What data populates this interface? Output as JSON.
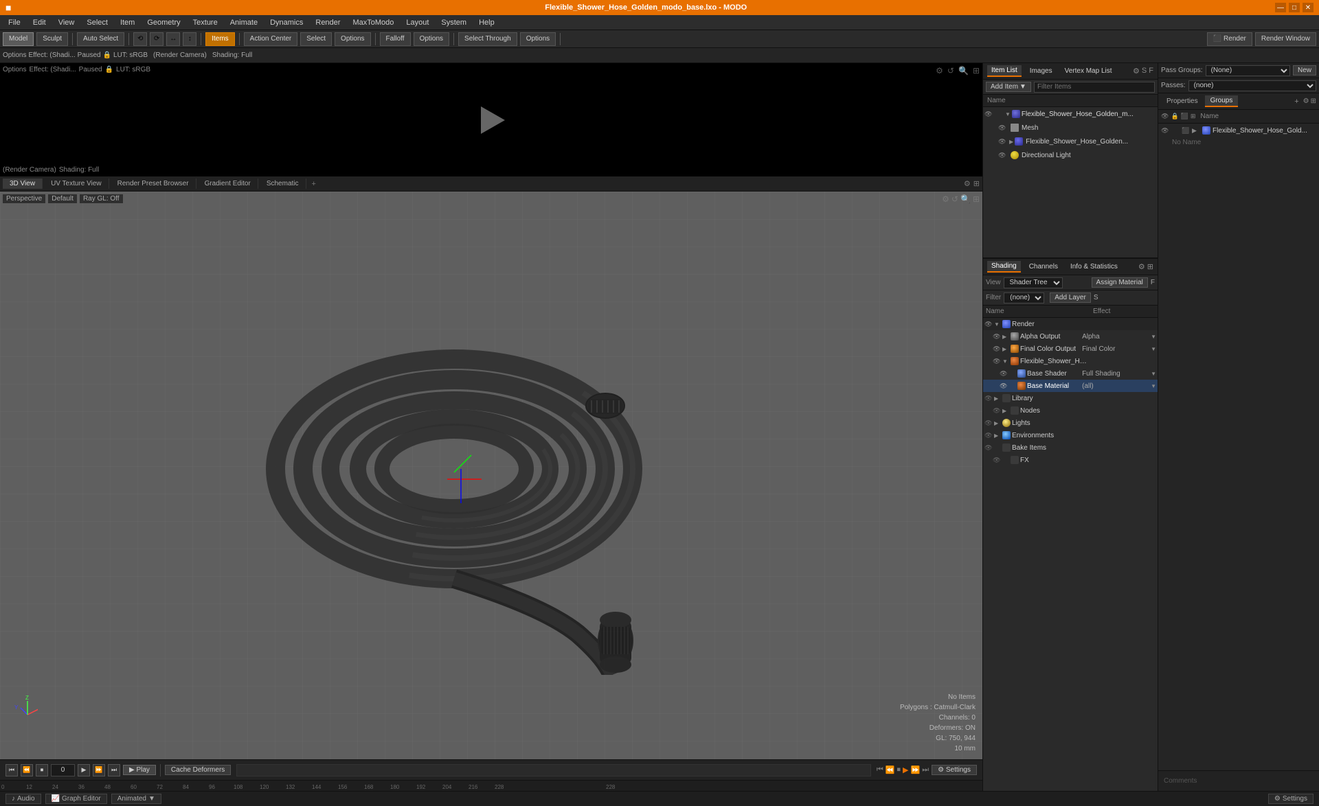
{
  "titleBar": {
    "title": "Flexible_Shower_Hose_Golden_modo_base.lxo - MODO",
    "winButtons": [
      "—",
      "□",
      "✕"
    ]
  },
  "menuBar": {
    "items": [
      "File",
      "Edit",
      "View",
      "Select",
      "Item",
      "Geometry",
      "Texture",
      "Animate",
      "Dynamics",
      "Render",
      "MaxToModo",
      "Layout",
      "System",
      "Help"
    ]
  },
  "toolbar": {
    "modeButtons": [
      "Model",
      "Sculpt"
    ],
    "autoSelect": "Auto Select",
    "transformButtons": [
      "⟲",
      "⟳",
      "↔",
      "↕"
    ],
    "itemsBtn": "Items",
    "actionCenter": "Action Center",
    "selectBtn": "Select",
    "optionsBtn1": "Options",
    "falloffBtn": "Falloff",
    "optionsBtn2": "Options",
    "selectThrough": "Select Through",
    "optionsBtn3": "Options",
    "renderBtn": "Render",
    "renderWindow": "Render Window"
  },
  "optionsBar": {
    "effect": "Effect: (Shadi...",
    "paused": "Paused",
    "lut": "LUT: sRGB",
    "renderCamera": "(Render Camera)",
    "shading": "Shading: Full"
  },
  "viewportTabs": {
    "tabs": [
      "3D View",
      "UV Texture View",
      "Render Preset Browser",
      "Gradient Editor",
      "Schematic",
      "+"
    ]
  },
  "viewport": {
    "perspective": "Perspective",
    "default": "Default",
    "rayGL": "Ray GL: Off",
    "noItems": "No Items",
    "polygons": "Polygons : Catmull-Clark",
    "channels": "Channels: 0",
    "deformers": "Deformers: ON",
    "gl": "GL: 750, 944",
    "scale": "10 mm"
  },
  "previewArea": {
    "options": "Options",
    "effect": "Effect: (Shadi...)",
    "paused": "Paused",
    "lut": "LUT: sRGB",
    "renderCamera": "(Render Camera)",
    "shading": "Shading: Full"
  },
  "itemListPanel": {
    "tabs": [
      "Item List",
      "Images",
      "Vertex Map List"
    ],
    "addItem": "Add Item",
    "filterItems": "Filter Items",
    "colHeader": "Name",
    "items": [
      {
        "level": 0,
        "name": "Flexible_Shower_Hose_Golden_m...",
        "expanded": true,
        "eye": true
      },
      {
        "level": 1,
        "name": "Mesh",
        "expanded": false,
        "eye": true
      },
      {
        "level": 1,
        "name": "Flexible_Shower_Hose_Golden...",
        "expanded": false,
        "eye": true
      },
      {
        "level": 1,
        "name": "Directional Light",
        "expanded": false,
        "eye": true
      }
    ]
  },
  "shadingPanel": {
    "tabs": [
      "Shading",
      "Channels",
      "Info & Statistics"
    ],
    "viewLabel": "View",
    "viewValue": "Shader Tree",
    "assignMaterial": "Assign Material",
    "filterLabel": "Filter",
    "filterValue": "(none)",
    "addLayer": "Add Layer",
    "colName": "Name",
    "colEffect": "Effect",
    "rows": [
      {
        "level": 0,
        "name": "Render",
        "effect": "",
        "icon": "render",
        "expanded": true,
        "eye": true
      },
      {
        "level": 1,
        "name": "Alpha Output",
        "effect": "Alpha",
        "icon": "output",
        "hasArrow": true,
        "eye": true
      },
      {
        "level": 1,
        "name": "Final Color Output",
        "effect": "Final Color",
        "icon": "output",
        "hasArrow": true,
        "eye": true
      },
      {
        "level": 1,
        "name": "Flexible_Shower_Hose_Gol...",
        "effect": "",
        "icon": "material",
        "expanded": true,
        "eye": true
      },
      {
        "level": 2,
        "name": "Base Shader",
        "effect": "Full Shading",
        "icon": "shader",
        "hasArrow": true,
        "eye": true
      },
      {
        "level": 2,
        "name": "Base Material",
        "effect": "(all)",
        "icon": "material2",
        "hasArrow": true,
        "eye": true
      },
      {
        "level": 0,
        "name": "Library",
        "effect": "",
        "icon": "library",
        "expanded": false,
        "eye": false
      },
      {
        "level": 1,
        "name": "Nodes",
        "effect": "",
        "icon": "nodes",
        "expanded": false,
        "eye": false
      },
      {
        "level": 0,
        "name": "Lights",
        "effect": "",
        "icon": "lights",
        "expanded": false,
        "eye": false
      },
      {
        "level": 0,
        "name": "Environments",
        "effect": "",
        "icon": "env",
        "expanded": false,
        "eye": false
      },
      {
        "level": 0,
        "name": "Bake Items",
        "effect": "",
        "icon": "bake",
        "expanded": false,
        "eye": false
      },
      {
        "level": 1,
        "name": "FX",
        "effect": "",
        "icon": "fx",
        "expanded": false,
        "eye": false
      }
    ]
  },
  "passGroups": {
    "label": "Pass Groups:",
    "value": "(None)",
    "newBtn": "New",
    "passesLabel": "Passes:",
    "passesValue": "(none)"
  },
  "groupsPanel": {
    "tabs": [
      "Properties",
      "Groups"
    ],
    "colHeader": "Name",
    "items": [
      {
        "name": "Flexible_Shower_Hose_Gold...",
        "eye": true
      }
    ],
    "noName": "No Name"
  },
  "timeline": {
    "transportBtns": [
      "⏮",
      "⏪",
      "⏹"
    ],
    "frame": "0",
    "playBtns": [
      "▶",
      "⏩",
      "⏭"
    ],
    "playLabel": "Play",
    "cacheDeformers": "Cache Deformers",
    "settingsBtn": "Settings"
  },
  "ruler": {
    "marks": [
      "0",
      "12",
      "24",
      "36",
      "48",
      "60",
      "72",
      "84",
      "96",
      "108",
      "120",
      "132",
      "144",
      "156",
      "168",
      "180",
      "192",
      "204",
      "216",
      "228"
    ]
  },
  "statusBar": {
    "audioBtn": "Audio",
    "graphEditor": "Graph Editor",
    "animatedBtn": "Animated",
    "settingsBtn": "Settings"
  }
}
